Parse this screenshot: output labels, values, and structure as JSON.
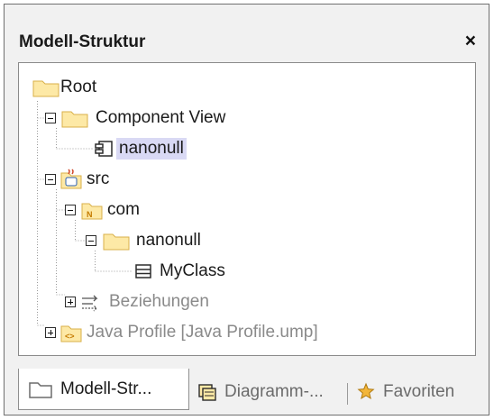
{
  "panel": {
    "title": "Modell-Struktur",
    "close_label": "×"
  },
  "tree": {
    "root": "Root",
    "component_view": "Component View",
    "nanonull_component": "nanonull",
    "src": "src",
    "com": "com",
    "nanonull_package": "nanonull",
    "myclass": "MyClass",
    "beziehungen": "Beziehungen",
    "java_profile": "Java Profile [Java Profile.ump]"
  },
  "tabs": [
    {
      "label": "Modell-Str...",
      "active": true
    },
    {
      "label": "Diagramm-...",
      "active": false
    },
    {
      "label": "Favoriten",
      "active": false
    }
  ],
  "colors": {
    "selection": "#d9d9f4",
    "folder": "#fde9a6",
    "muted_text": "#8a8a8a"
  }
}
